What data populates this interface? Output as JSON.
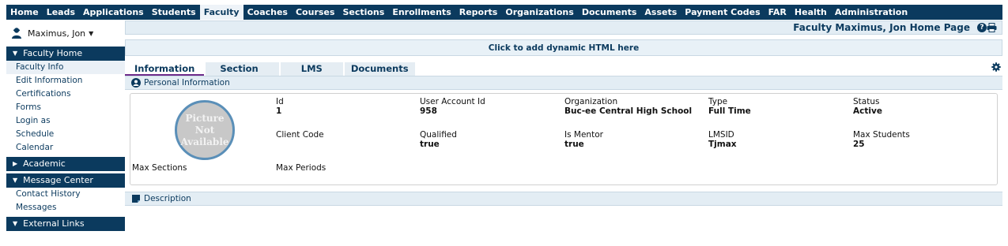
{
  "nav": {
    "items": [
      "Home",
      "Leads",
      "Applications",
      "Students",
      "Faculty",
      "Coaches",
      "Courses",
      "Sections",
      "Enrollments",
      "Reports",
      "Organizations",
      "Documents",
      "Assets",
      "Payment Codes",
      "FAR",
      "Health",
      "Administration"
    ],
    "active": "Faculty"
  },
  "user": {
    "name": "Maximus, Jon"
  },
  "sidebar": {
    "faculty_home": "Faculty Home",
    "faculty_links": [
      "Faculty Info",
      "Edit Information",
      "Certifications",
      "Forms",
      "Login as",
      "Schedule",
      "Calendar"
    ],
    "academic": "Academic",
    "message_center": "Message Center",
    "message_links": [
      "Contact History",
      "Messages"
    ],
    "external_links": "External Links"
  },
  "header": {
    "title": "Faculty Maximus, Jon Home Page"
  },
  "dynamic_html": "Click to add dynamic HTML here",
  "tabs": [
    "Information",
    "Section",
    "LMS",
    "Documents"
  ],
  "personal": {
    "title": "Personal Information",
    "picture_text": [
      "Picture",
      "Not",
      "Available"
    ],
    "fields": {
      "id": {
        "label": "Id",
        "value": "1"
      },
      "user_account_id": {
        "label": "User Account Id",
        "value": "958"
      },
      "organization": {
        "label": "Organization",
        "value": "Buc-ee Central High School"
      },
      "type": {
        "label": "Type",
        "value": "Full Time"
      },
      "status": {
        "label": "Status",
        "value": "Active"
      },
      "client_code": {
        "label": "Client Code",
        "value": ""
      },
      "qualified": {
        "label": "Qualified",
        "value": "true"
      },
      "is_mentor": {
        "label": "Is Mentor",
        "value": "true"
      },
      "lmsid": {
        "label": "LMSID",
        "value": "Tjmax"
      },
      "max_students": {
        "label": "Max Students",
        "value": "25"
      },
      "max_sections": {
        "label": "Max Sections",
        "value": ""
      },
      "max_periods": {
        "label": "Max Periods",
        "value": ""
      }
    }
  },
  "description": {
    "title": "Description"
  },
  "colors": {
    "nav_bg": "#0b3a5e",
    "panel_bg": "#e3edf4",
    "tab_accent": "#6d2a8a"
  }
}
